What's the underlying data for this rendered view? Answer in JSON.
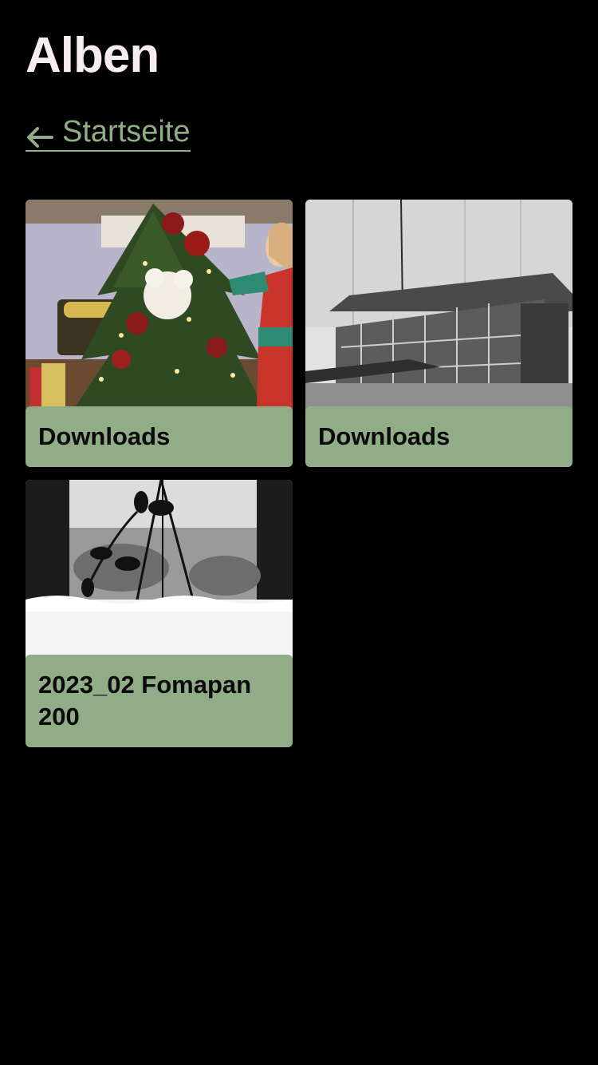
{
  "header": {
    "title": "Alben"
  },
  "nav": {
    "back_label": "Startseite",
    "back_icon": "arrow-left-icon"
  },
  "colors": {
    "background": "#000000",
    "title": "#f7ecef",
    "accent": "#91ad87",
    "card_text": "#0a0a0a"
  },
  "albums": [
    {
      "label": "Downloads",
      "thumbnail": "christmas-tree-photo"
    },
    {
      "label": "Downloads",
      "thumbnail": "barn-bw-photo"
    },
    {
      "label": "2023_02 Fomapan 200",
      "thumbnail": "window-plant-bw-photo"
    }
  ]
}
